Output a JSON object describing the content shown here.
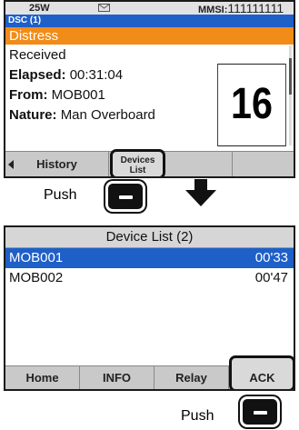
{
  "screen1": {
    "status": {
      "power": "25W",
      "mmsi_label": "MMSI:",
      "mmsi_value": "111111111"
    },
    "dsc_tab": "DSC (1)",
    "header": "Distress",
    "received": "Received",
    "elapsed_label": "Elapsed:",
    "elapsed_value": "00:31:04",
    "from_label": "From:",
    "from_value": "MOB001",
    "nature_label": "Nature:",
    "nature_value": "Man Overboard",
    "big_number": "16",
    "softkeys": {
      "history": "History",
      "devices_line1": "Devices",
      "devices_line2": "List"
    }
  },
  "annotations": {
    "push1": "Push",
    "push2": "Push"
  },
  "screen2": {
    "title": "Device List (2)",
    "devices": [
      {
        "name": "MOB001",
        "time": "00'33",
        "selected": true
      },
      {
        "name": "MOB002",
        "time": "00'47",
        "selected": false
      }
    ],
    "softkeys": {
      "home": "Home",
      "info": "INFO",
      "relay": "Relay",
      "ack": "ACK"
    }
  },
  "colors": {
    "selection_blue": "#1e5fc8",
    "distress_orange": "#f28c18",
    "softkey_gray": "#c9c9c9"
  },
  "icons": [
    "mail-icon",
    "left-arrow-icon",
    "down-arrow-icon",
    "push-button-icon"
  ]
}
